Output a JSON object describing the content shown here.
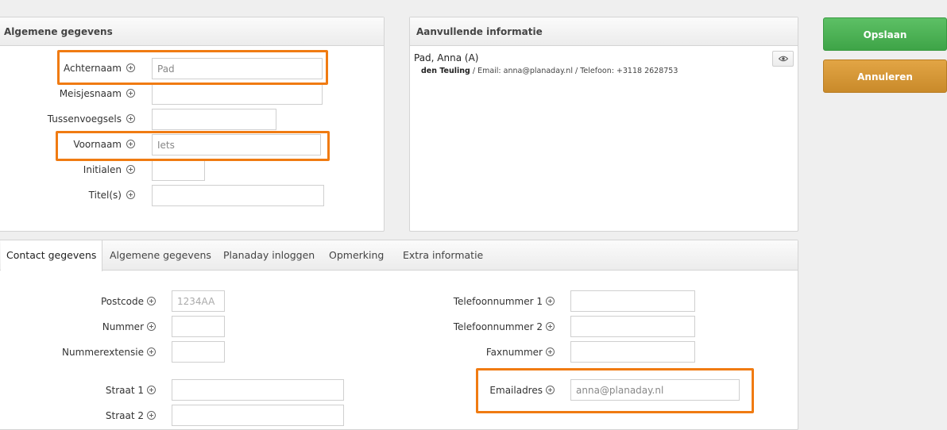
{
  "actions": {
    "save_label": "Opslaan",
    "cancel_label": "Annuleren"
  },
  "general_panel": {
    "title": "Algemene gegevens",
    "fields": [
      {
        "label": "Achternaam",
        "value": "Pad"
      },
      {
        "label": "Meisjesnaam",
        "value": ""
      },
      {
        "label": "Tussenvoegsels",
        "value": ""
      },
      {
        "label": "Voornaam",
        "value": "Iets"
      },
      {
        "label": "Initialen",
        "value": ""
      },
      {
        "label": "Titel(s)",
        "value": ""
      }
    ]
  },
  "info_panel": {
    "title": "Aanvullende informatie",
    "name": "Pad, Anna (A)",
    "location": "den Teuling",
    "details": " / Email: anna@planaday.nl / Telefoon: +3118 2628753"
  },
  "tabs": [
    {
      "label": "Contact gegevens",
      "active": true
    },
    {
      "label": "Algemene gegevens",
      "active": false
    },
    {
      "label": "Planaday inloggen",
      "active": false
    },
    {
      "label": "Opmerking",
      "active": false
    },
    {
      "label": "Extra informatie",
      "active": false
    }
  ],
  "contact": {
    "left_fields": [
      {
        "label": "Postcode",
        "value": "",
        "placeholder": "1234AA"
      },
      {
        "label": "Nummer",
        "value": ""
      },
      {
        "label": "Nummerextensie",
        "value": ""
      },
      {
        "label": "Straat 1",
        "value": ""
      },
      {
        "label": "Straat 2",
        "value": ""
      }
    ],
    "right_fields": [
      {
        "label": "Telefoonnummer 1",
        "value": ""
      },
      {
        "label": "Telefoonnummer 2",
        "value": ""
      },
      {
        "label": "Faxnummer",
        "value": ""
      },
      {
        "label": "Emailadres",
        "value": "anna@planaday.nl"
      }
    ]
  },
  "colors": {
    "highlight": "#f07b12",
    "save": "#4cb154",
    "cancel": "#d49935"
  }
}
